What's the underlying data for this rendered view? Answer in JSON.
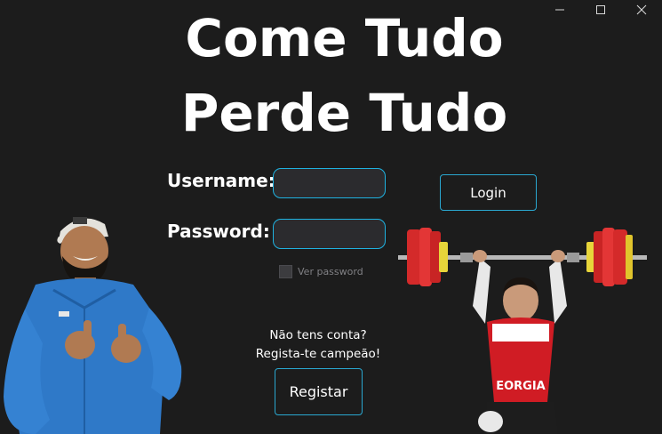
{
  "window": {
    "minimize_icon": "minimize-icon",
    "maximize_icon": "maximize-icon",
    "close_icon": "close-icon"
  },
  "title": {
    "line1": "Come Tudo",
    "line2": "Perde Tudo"
  },
  "form": {
    "username_label": "Username:",
    "username_value": "",
    "password_label": "Password:",
    "password_value": "",
    "show_password_label": "Ver password",
    "show_password_checked": false,
    "login_label": "Login"
  },
  "register": {
    "prompt_line1": "Não tens conta?",
    "prompt_line2": "Regista-te campeão!",
    "button_label": "Registar"
  },
  "colors": {
    "background": "#1c1c1c",
    "accent": "#1fb2e0",
    "field_bg": "#2b2b2e"
  }
}
